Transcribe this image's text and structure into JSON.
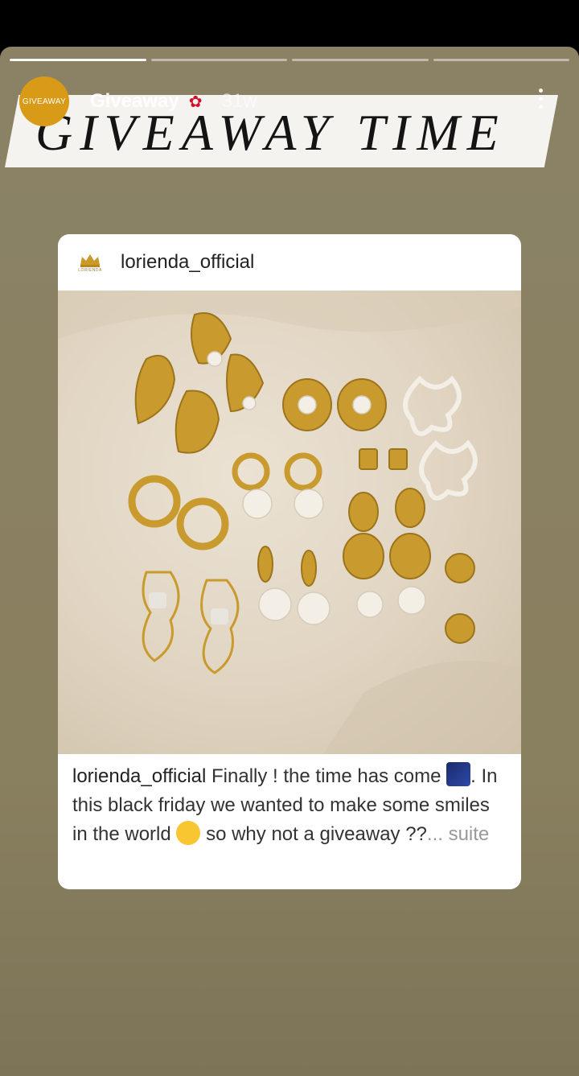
{
  "story": {
    "progress_segments": 4,
    "active_segment": 0,
    "avatar_text": "GIVEAWAY",
    "username": "Giveaway",
    "username_emoji": "rose-emoji",
    "time": "31w",
    "banner_text": "GIVEAWAY TIME"
  },
  "post": {
    "username": "lorienda_official",
    "logo": "crown-logo",
    "logo_text": "LORIENDA",
    "caption_user": "lorienda_official",
    "caption_part1": " Finally ! the time has come ",
    "caption_part2": ". In this black friday we wanted to make some smiles in the world ",
    "caption_part3": " so why not a giveaway ??",
    "more_label": "... suite"
  },
  "colors": {
    "background": "#89805f",
    "avatar": "#d89a17",
    "banner": "#f4f3ef"
  }
}
